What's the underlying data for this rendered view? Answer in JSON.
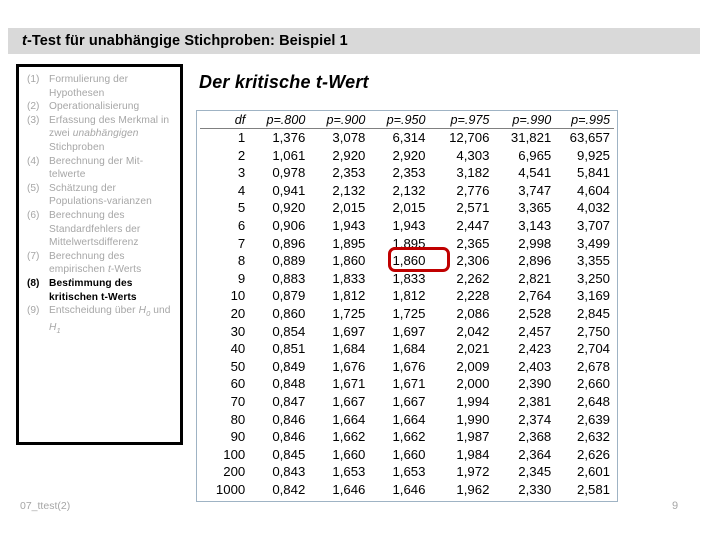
{
  "slide": {
    "title_italic_prefix": "t",
    "title_rest": "-Test für unabhängige Stichproben: Beispiel 1",
    "heading": "Der kritische t-Wert",
    "accent_color": "#c00000",
    "title_bar_color": "#d9d9d9",
    "muted_color": "#a6a6a6"
  },
  "steps": {
    "items": [
      {
        "num": "(1)",
        "text": "Formulierung der Hypothesen",
        "active": false
      },
      {
        "num": "(2)",
        "text": "Operationalisierung",
        "active": false
      },
      {
        "num": "(3)",
        "text": "Erfassung des Merkmal in zwei unabhängigen Stichproben",
        "active": false,
        "italic_word": "unabhängigen"
      },
      {
        "num": "(4)",
        "text": "Berechnung der Mit-telwerte",
        "active": false
      },
      {
        "num": "(5)",
        "text": "Schätzung der Populations-varianzen",
        "active": false
      },
      {
        "num": "(6)",
        "text": "Berechnung des Standardfehlers der Mittelwertsdifferenz",
        "active": false
      },
      {
        "num": "(7)",
        "text": "Berechnung des empirischen t-Werts",
        "active": false,
        "italic_word": "t"
      },
      {
        "num": "(8)",
        "text": "Bestimmung des kritischen t-Werts",
        "active": true,
        "italic_word": "t"
      },
      {
        "num": "(9)",
        "text": "Entscheidung über H0 und H1",
        "active": false
      }
    ]
  },
  "table": {
    "columns": [
      "df",
      "p=.800",
      "p=.900",
      "p=.950",
      "p=.975",
      "p=.990",
      "p=.995"
    ],
    "rows": [
      [
        "1",
        "1,376",
        "3,078",
        "6,314",
        "12,706",
        "31,821",
        "63,657"
      ],
      [
        "2",
        "1,061",
        "2,920",
        "2,920",
        "4,303",
        "6,965",
        "9,925"
      ],
      [
        "3",
        "0,978",
        "2,353",
        "2,353",
        "3,182",
        "4,541",
        "5,841"
      ],
      [
        "4",
        "0,941",
        "2,132",
        "2,132",
        "2,776",
        "3,747",
        "4,604"
      ],
      [
        "5",
        "0,920",
        "2,015",
        "2,015",
        "2,571",
        "3,365",
        "4,032"
      ],
      [
        "6",
        "0,906",
        "1,943",
        "1,943",
        "2,447",
        "3,143",
        "3,707"
      ],
      [
        "7",
        "0,896",
        "1,895",
        "1,895",
        "2,365",
        "2,998",
        "3,499"
      ],
      [
        "8",
        "0,889",
        "1,860",
        "1,860",
        "2,306",
        "2,896",
        "3,355"
      ],
      [
        "9",
        "0,883",
        "1,833",
        "1,833",
        "2,262",
        "2,821",
        "3,250"
      ],
      [
        "10",
        "0,879",
        "1,812",
        "1,812",
        "2,228",
        "2,764",
        "3,169"
      ],
      [
        "20",
        "0,860",
        "1,725",
        "1,725",
        "2,086",
        "2,528",
        "2,845"
      ],
      [
        "30",
        "0,854",
        "1,697",
        "1,697",
        "2,042",
        "2,457",
        "2,750"
      ],
      [
        "40",
        "0,851",
        "1,684",
        "1,684",
        "2,021",
        "2,423",
        "2,704"
      ],
      [
        "50",
        "0,849",
        "1,676",
        "1,676",
        "2,009",
        "2,403",
        "2,678"
      ],
      [
        "60",
        "0,848",
        "1,671",
        "1,671",
        "2,000",
        "2,390",
        "2,660"
      ],
      [
        "70",
        "0,847",
        "1,667",
        "1,667",
        "1,994",
        "2,381",
        "2,648"
      ],
      [
        "80",
        "0,846",
        "1,664",
        "1,664",
        "1,990",
        "2,374",
        "2,639"
      ],
      [
        "90",
        "0,846",
        "1,662",
        "1,662",
        "1,987",
        "2,368",
        "2,632"
      ],
      [
        "100",
        "0,845",
        "1,660",
        "1,660",
        "1,984",
        "2,364",
        "2,626"
      ],
      [
        "200",
        "0,843",
        "1,653",
        "1,653",
        "1,972",
        "2,345",
        "2,601"
      ],
      [
        "1000",
        "0,842",
        "1,646",
        "1,646",
        "1,962",
        "2,330",
        "2,581"
      ]
    ],
    "highlight": {
      "row_df": "8",
      "column": "p=.950",
      "value": "1,860"
    }
  },
  "footer": {
    "file_label": "07_ttest(2)",
    "page_number": "9"
  }
}
